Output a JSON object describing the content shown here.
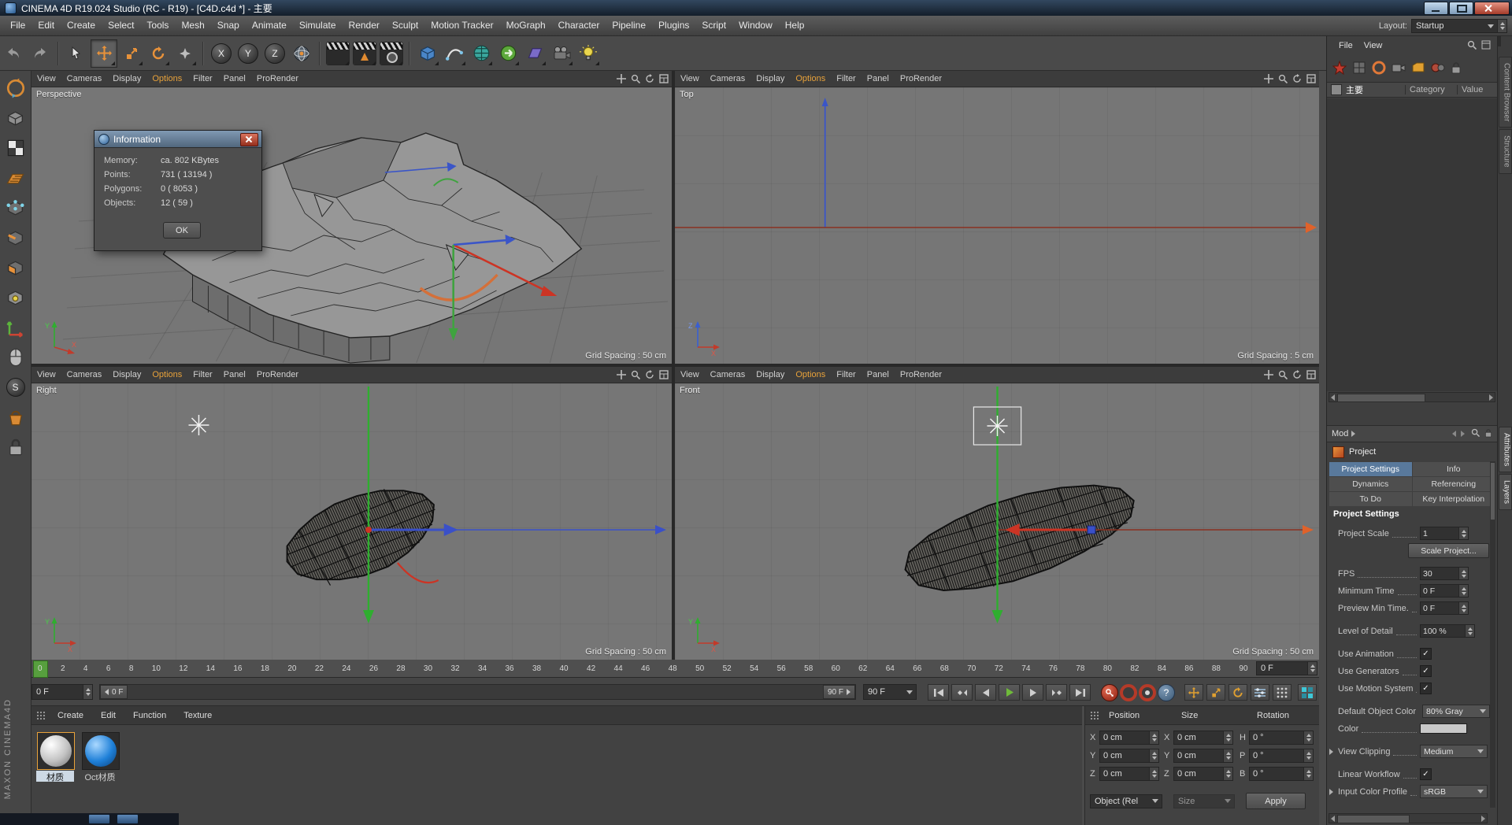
{
  "window": {
    "title": "CINEMA 4D R19.024 Studio (RC - R19) - [C4D.c4d *] - 主要"
  },
  "menu_bar": {
    "items": [
      "File",
      "Edit",
      "Create",
      "Select",
      "Tools",
      "Mesh",
      "Snap",
      "Animate",
      "Simulate",
      "Render",
      "Sculpt",
      "Motion Tracker",
      "MoGraph",
      "Character",
      "Pipeline",
      "Plugins",
      "Script",
      "Window",
      "Help"
    ],
    "layout_label": "Layout:",
    "layout_value": "Startup"
  },
  "toolbar": {
    "axis_x": "X",
    "axis_y": "Y",
    "axis_z": "Z"
  },
  "left_toolbar": {
    "snap_letter": "S",
    "brand": "MAXON CINEMA4D"
  },
  "viewports": {
    "menu": [
      "View",
      "Cameras",
      "Display",
      "Options",
      "Filter",
      "Panel",
      "ProRender"
    ],
    "perspective": {
      "name": "Perspective",
      "grid": "Grid Spacing : 50 cm"
    },
    "top": {
      "name": "Top",
      "grid": "Grid Spacing : 5 cm"
    },
    "right": {
      "name": "Right",
      "grid": "Grid Spacing : 50 cm"
    },
    "front": {
      "name": "Front",
      "grid": "Grid Spacing : 50 cm"
    }
  },
  "axis_gizmo": {
    "up_y": "Y",
    "up_z": "Z",
    "right_x": "X"
  },
  "info_dialog": {
    "title": "Information",
    "rows": [
      {
        "label": "Memory:",
        "value": "ca. 802 KBytes"
      },
      {
        "label": "Points:",
        "value": "731 ( 13194 )"
      },
      {
        "label": "Polygons:",
        "value": "0 ( 8053 )"
      },
      {
        "label": "Objects:",
        "value": "12 ( 59 )"
      }
    ],
    "ok": "OK"
  },
  "timeline": {
    "ticks": [
      "0",
      "2",
      "4",
      "6",
      "8",
      "10",
      "12",
      "14",
      "16",
      "18",
      "20",
      "22",
      "24",
      "26",
      "28",
      "30",
      "32",
      "34",
      "36",
      "38",
      "40",
      "42",
      "44",
      "46",
      "48",
      "50",
      "52",
      "54",
      "56",
      "58",
      "60",
      "62",
      "64",
      "66",
      "68",
      "70",
      "72",
      "74",
      "76",
      "78",
      "80",
      "82",
      "84",
      "86",
      "88",
      "90"
    ],
    "end_frame": "0 F"
  },
  "transport": {
    "current_frame": "0 F",
    "range_start": "0 F",
    "range_end": "90 F",
    "range_combo": "90 F"
  },
  "material_manager": {
    "tabs": [
      "Create",
      "Edit",
      "Function",
      "Texture"
    ],
    "materials": [
      {
        "name": "材质"
      },
      {
        "name": "Oct材质"
      }
    ]
  },
  "coordinates": {
    "columns": [
      {
        "header": "Position",
        "rows": [
          {
            "l": "X",
            "v": "0 cm"
          },
          {
            "l": "Y",
            "v": "0 cm"
          },
          {
            "l": "Z",
            "v": "0 cm"
          }
        ]
      },
      {
        "header": "Size",
        "rows": [
          {
            "l": "X",
            "v": "0 cm"
          },
          {
            "l": "Y",
            "v": "0 cm"
          },
          {
            "l": "Z",
            "v": "0 cm"
          }
        ]
      },
      {
        "header": "Rotation",
        "rows": [
          {
            "l": "H",
            "v": "0 °"
          },
          {
            "l": "P",
            "v": "0 °"
          },
          {
            "l": "B",
            "v": "0 °"
          }
        ]
      }
    ],
    "mode": "Object (Rel",
    "size_mode": "Size",
    "apply": "Apply"
  },
  "take_manager": {
    "menus": [
      "File",
      "View"
    ],
    "take": "主要",
    "columns": [
      "Category",
      "Value"
    ]
  },
  "attribute_manager": {
    "mode": "Mod",
    "object": "Project",
    "tabs": [
      "Project Settings",
      "Info",
      "Dynamics",
      "Referencing",
      "To Do",
      "Key Interpolation"
    ],
    "section": "Project Settings",
    "rows": [
      {
        "label": "Project Scale",
        "value": "1"
      },
      {
        "label": "Scale Project..."
      },
      {
        "label": "FPS",
        "value": "30"
      },
      {
        "label": "Minimum Time",
        "value": "0 F"
      },
      {
        "label": "Preview Min Time.",
        "value": "0 F"
      },
      {
        "label": "Level of Detail",
        "value": "100 %"
      },
      {
        "label": "Use Animation"
      },
      {
        "label": "Use Generators"
      },
      {
        "label": "Use Motion System"
      },
      {
        "label": "Default Object Color",
        "value": "80% Gray"
      },
      {
        "label": "Color"
      },
      {
        "label": "View Clipping",
        "value": "Medium"
      },
      {
        "label": "Linear Workflow"
      },
      {
        "label": "Input Color Profile",
        "value": "sRGB"
      }
    ]
  },
  "side_tabs": {
    "top": [
      "Content Browser",
      "Structure"
    ],
    "bottom": [
      "Attributes",
      "Layers"
    ]
  },
  "icons": {
    "check": "✓",
    "question": "?"
  }
}
